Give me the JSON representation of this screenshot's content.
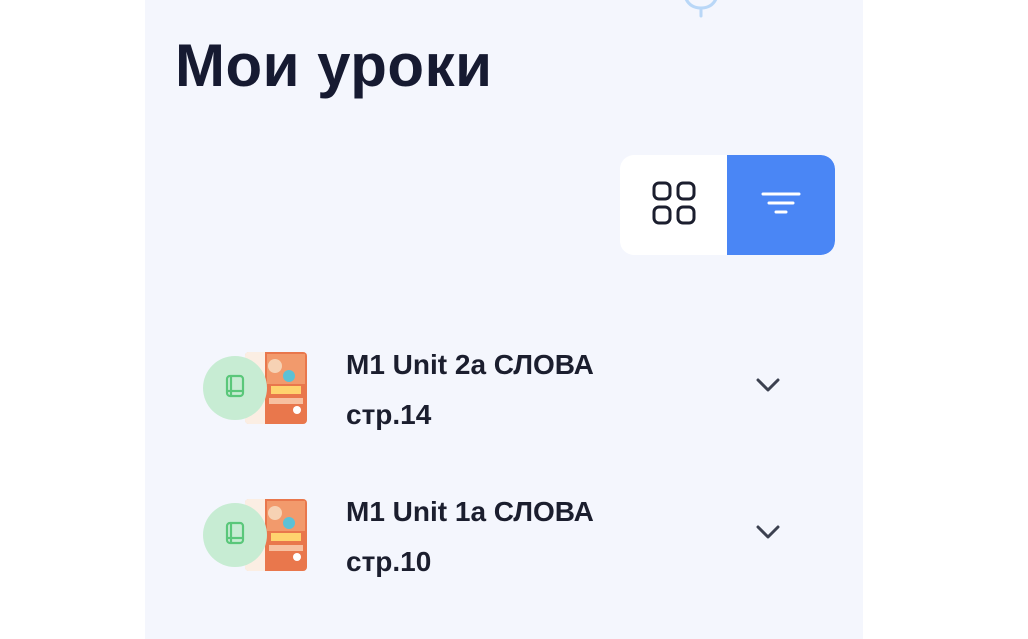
{
  "page": {
    "title": "Мои уроки"
  },
  "view_toggle": {
    "options": [
      {
        "name": "grid",
        "icon": "grid-icon",
        "active": false
      },
      {
        "name": "list-filter",
        "icon": "filter-lines-icon",
        "active": true
      }
    ],
    "active_color": "#4a86f5"
  },
  "lessons": [
    {
      "title_line1": "M1 Unit 2a СЛОВА",
      "title_line2": "стр.14",
      "icon": "book-icon"
    },
    {
      "title_line1": "M1 Unit 1a СЛОВА",
      "title_line2": "стр.10",
      "icon": "book-icon"
    }
  ],
  "colors": {
    "background": "#f4f6fd",
    "title_text": "#161a31",
    "badge": "#c7ecd3",
    "badge_icon": "#5ac77a"
  }
}
